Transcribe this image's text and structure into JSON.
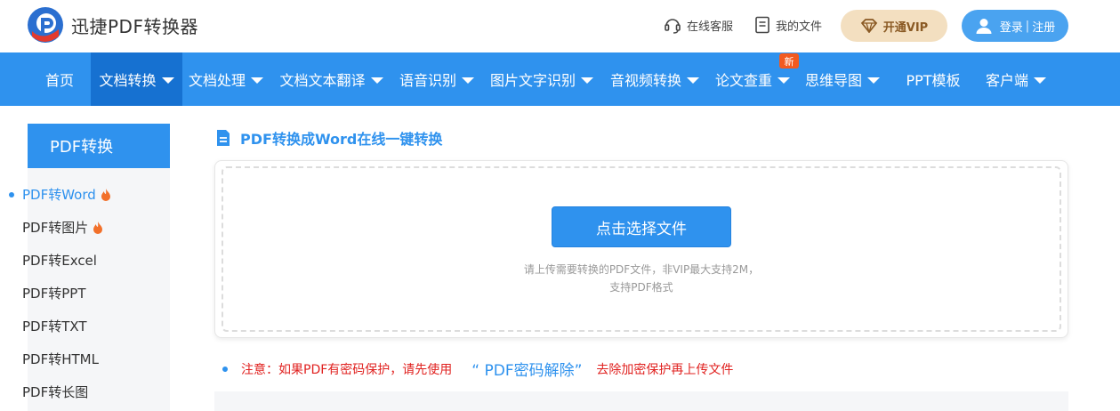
{
  "header": {
    "app_title": "迅捷PDF转换器",
    "customer_service": "在线客服",
    "my_files": "我的文件",
    "vip_label": "开通VIP",
    "login": "登录",
    "separator": "|",
    "register": "注册"
  },
  "nav": {
    "items": [
      {
        "label": "首页"
      },
      {
        "label": "文档转换"
      },
      {
        "label": "文档处理"
      },
      {
        "label": "文档文本翻译"
      },
      {
        "label": "语音识别"
      },
      {
        "label": "图片文字识别"
      },
      {
        "label": "音视频转换"
      },
      {
        "label": "论文查重"
      },
      {
        "label": "思维导图"
      },
      {
        "label": "PPT模板"
      },
      {
        "label": "客户端"
      }
    ],
    "badge_new": "新"
  },
  "sidebar": {
    "heading": "PDF转换",
    "items": [
      {
        "label": "PDF转Word"
      },
      {
        "label": "PDF转图片"
      },
      {
        "label": "PDF转Excel"
      },
      {
        "label": "PDF转PPT"
      },
      {
        "label": "PDF转TXT"
      },
      {
        "label": "PDF转HTML"
      },
      {
        "label": "PDF转长图"
      }
    ]
  },
  "main": {
    "title": "PDF转换成Word在线一键转换",
    "select_button": "点击选择文件",
    "hint_line1": "请上传需要转换的PDF文件，非VIP最大支持2M，",
    "hint_line2": "支持PDF格式",
    "notice_prefix": "注意：如果PDF有密码保护，请先使用",
    "notice_link": "“ PDF密码解除”",
    "notice_suffix": "去除加密保护再上传文件"
  },
  "colors": {
    "brand_blue": "#2f92ee",
    "nav_active": "#1671d1",
    "notice_red": "#e0211f",
    "vip_bg": "#f3dfc0"
  }
}
